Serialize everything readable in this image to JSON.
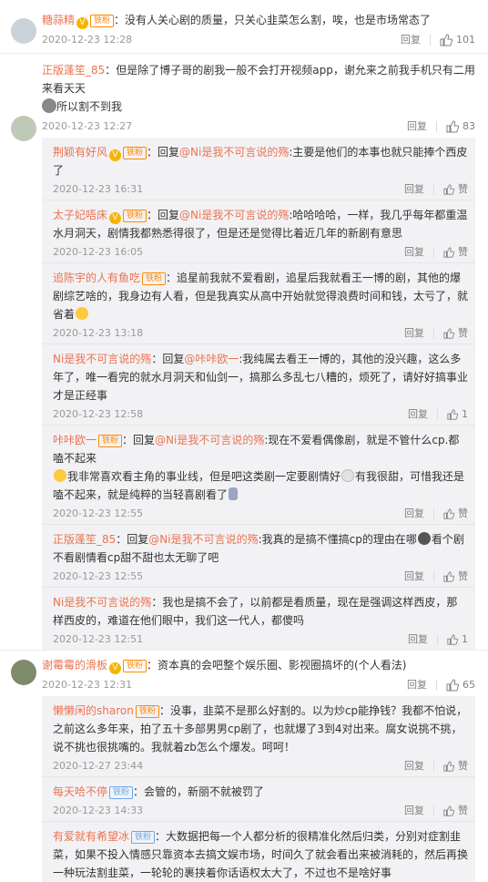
{
  "comments": [
    {
      "user": "糖蒜精",
      "badge": "铁粉",
      "text": "：没有人关心剧的质量，只关心韭菜怎么割，唉，也是市场常态了",
      "time": "2020-12-23 12:28",
      "reply_label": "回复",
      "likes": "101"
    },
    {
      "user": "正版蓬笙_85",
      "text": "：但是除了博子哥的剧我一般不会打开视频app，谢允来之前我手机只有二用来看天天",
      "text2": "所以割不到我",
      "time": "2020-12-23 12:27",
      "reply_label": "回复",
      "likes": "83",
      "replies": [
        {
          "user": "荆颖有好风",
          "badge": "铁粉",
          "prefix": "：回复",
          "to": "@Ni是我不可言说的殇",
          "text": ":主要是他们的本事也就只能捧个西皮了",
          "time": "2020-12-23 16:31",
          "reply_label": "回复",
          "likes": "赞"
        },
        {
          "user": "太子妃唔床",
          "badge": "铁粉",
          "prefix": "：回复",
          "to": "@Ni是我不可言说的殇",
          "text": ":哈哈哈哈，一样，我几乎每年都重温水月洞天，剧情我都熟悉得很了，但是还是觉得比着近几年的新剧有意思",
          "time": "2020-12-23 16:05",
          "reply_label": "回复",
          "likes": "赞"
        },
        {
          "user": "追陈宇的人有鱼吃",
          "badge": "铁粉",
          "text": "：追星前我就不爱看剧，追星后我就看王一博的剧，其他的爆剧综艺啥的，我身边有人看，但是我真实从高中开始就觉得浪费时间和钱，太亏了，就省着",
          "time": "2020-12-23 13:18",
          "reply_label": "回复",
          "likes": "赞"
        },
        {
          "user": "Ni是我不可言说的殇",
          "prefix": "：回复",
          "to": "@咔咔欧一",
          "text": ":我纯属去看王一博的，其他的没兴趣，这么多年了，唯一看完的就水月洞天和仙剑一，搞那么多乱七八糟的，烦死了，请好好搞事业才是正经事",
          "time": "2020-12-23 12:58",
          "reply_label": "回复",
          "likes": "1"
        },
        {
          "user": "咔咔欧一",
          "badge": "铁粉",
          "prefix": "：回复",
          "to": "@Ni是我不可言说的殇",
          "text": ":现在不爱看偶像剧，就是不管什么cp.都嗑不起来",
          "text2": "我非常喜欢看主角的事业线，但是吧这类剧一定要剧情好",
          "text3": "有我很甜，可惜我还是嗑不起来，就是纯粹的当轻喜剧看了",
          "time": "2020-12-23 12:55",
          "reply_label": "回复",
          "likes": "赞"
        },
        {
          "user": "正版蓬笙_85",
          "prefix": "：回复",
          "to": "@Ni是我不可言说的殇",
          "text": ":我真的是搞不懂搞cp的理由在哪",
          "text2": "看个剧不看剧情看cp甜不甜也太无聊了吧",
          "time": "2020-12-23 12:55",
          "reply_label": "回复",
          "likes": "赞"
        },
        {
          "user": "Ni是我不可言说的殇",
          "text": "：我也是搞不会了，以前都是看质量，现在是强调这样西皮，那样西皮的，难道在他们眼中，我们这一代人，都傻吗",
          "time": "2020-12-23 12:51",
          "reply_label": "回复",
          "likes": "1"
        }
      ]
    },
    {
      "user": "谢霉霉的滑板",
      "badge": "铁粉",
      "text": "：资本真的会吧整个娱乐圈、影视圈搞坏的(个人看法)",
      "time": "2020-12-23 12:31",
      "reply_label": "回复",
      "likes": "65",
      "replies": [
        {
          "user": "懒懒闲的sharon",
          "badge": "铁粉",
          "text": "：没事，韭菜不是那么好割的。以为炒cp能挣钱？我都不怕说，之前这么多年来，拍了五十多部男男cp剧了，也就爆了3到4对出来。腐女说挑不挑，说不挑也很挑嘴的。我就着zb怎么个爆发。呵呵！",
          "time": "2020-12-27 23:44",
          "reply_label": "回复",
          "likes": "赞"
        },
        {
          "user": "每天哈不停",
          "badge": "铁粉",
          "text": "：会管的，新丽不就被罚了",
          "time": "2020-12-23 14:33",
          "reply_label": "回复",
          "likes": "赞"
        },
        {
          "user": "有爱就有希望冰",
          "badge": "铁粉",
          "text": "：大数据把每一个人都分析的很精准化然后归类，分别对症割韭菜，如果不投入情感只靠资本去搞文娱市场，时间久了就会看出来被消耗的，然后再换一种玩法割韭菜，一轮轮的裹挟着你话语权太大了，不过也不是啥好事",
          "time": "",
          "reply_label": "",
          "likes": ""
        }
      ]
    }
  ],
  "colors": {
    "username": "#eb7350",
    "badge": "#ff8a00",
    "vip": "#f6b400",
    "reply_bg": "#f2f2f5"
  },
  "icons": {
    "like": "thumb-up-icon",
    "vip": "vip-v-icon"
  }
}
